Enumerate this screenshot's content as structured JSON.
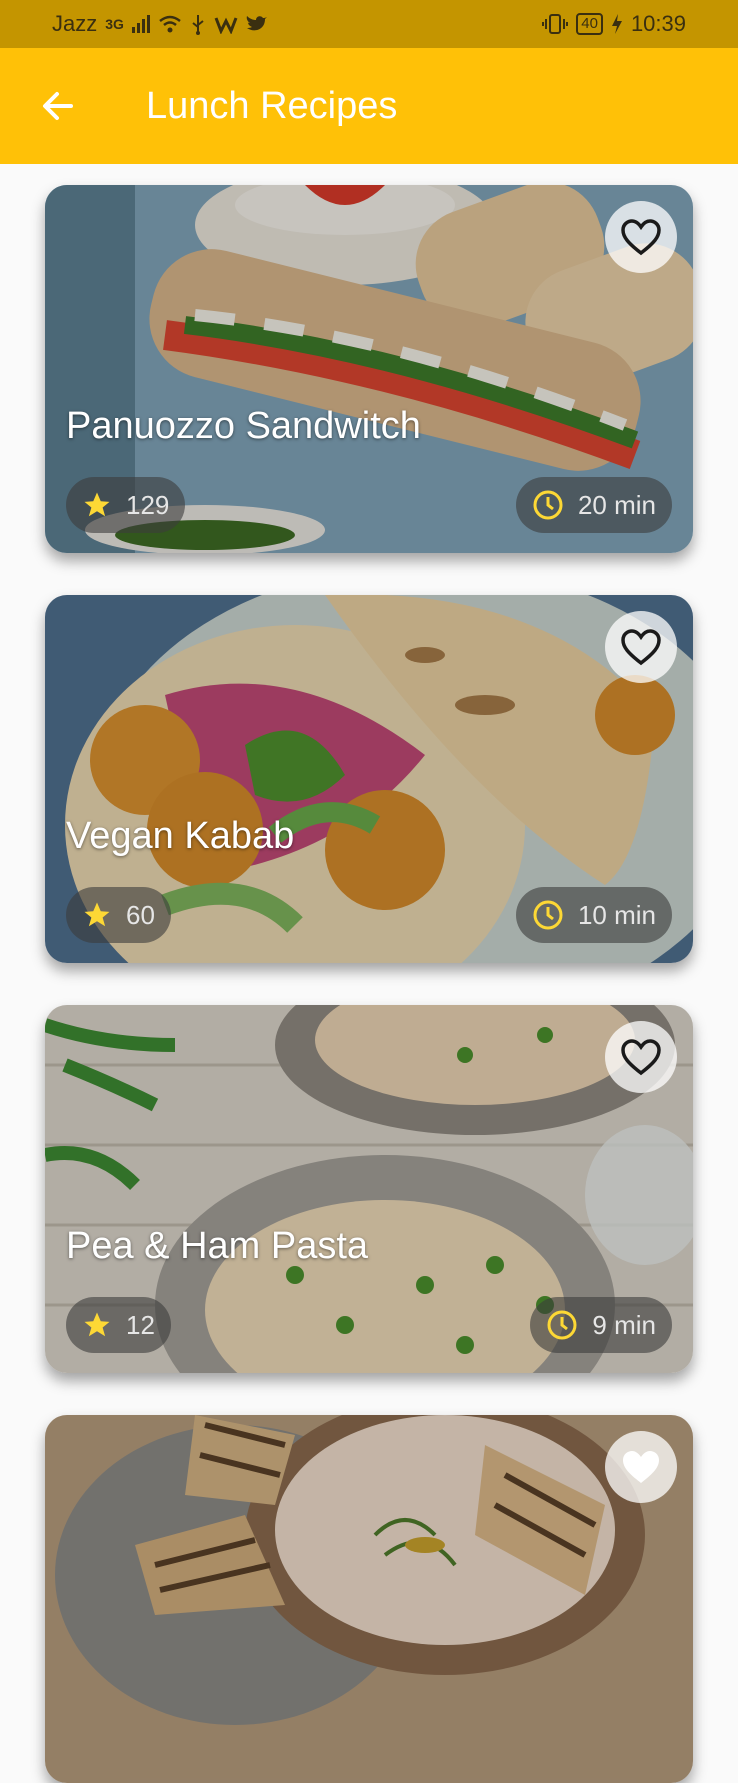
{
  "status_bar": {
    "carrier": "Jazz",
    "network": "3G",
    "battery": "40",
    "time": "10:39"
  },
  "app_bar": {
    "title": "Lunch Recipes",
    "back_icon": "arrow-left-icon"
  },
  "recipes": [
    {
      "title": "Panuozzo Sandwitch",
      "rating": "129",
      "time": "20 min",
      "favorite": false
    },
    {
      "title": "Vegan Kabab",
      "rating": "60",
      "time": "10 min",
      "favorite": false
    },
    {
      "title": "Pea & Ham Pasta",
      "rating": "12",
      "time": "9 min",
      "favorite": false
    },
    {
      "title": "",
      "rating": "",
      "time": "",
      "favorite": true
    }
  ],
  "colors": {
    "status_bar": "#c49500",
    "app_bar": "#ffc107",
    "star": "#fdd835",
    "clock": "#fdd835"
  }
}
